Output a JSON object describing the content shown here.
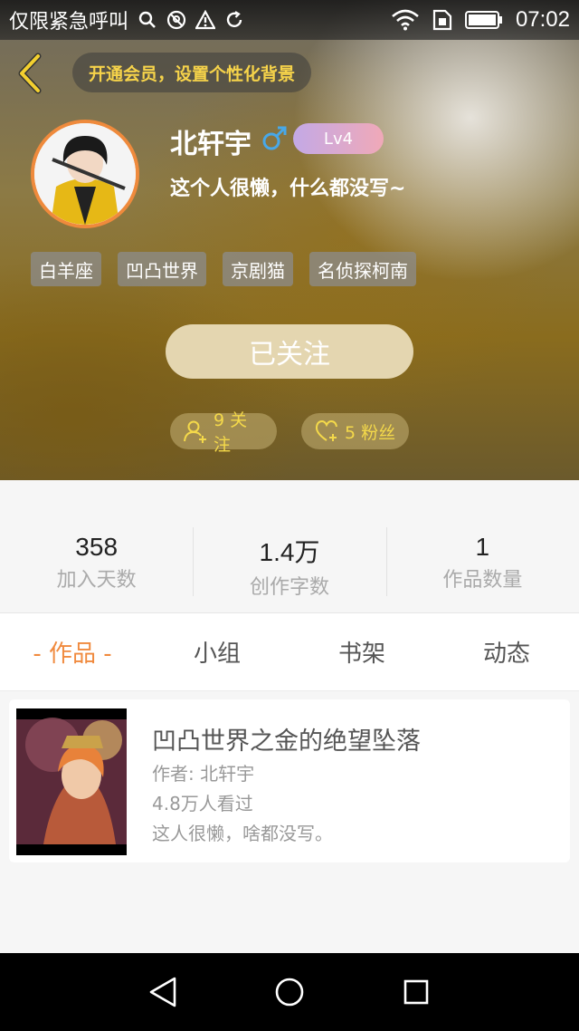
{
  "status_bar": {
    "carrier": "仅限紧急呼叫",
    "time": "07:02",
    "icons": [
      "search-icon",
      "no-location-icon",
      "warning-icon",
      "sync-icon",
      "wifi-icon",
      "sim-icon",
      "battery-icon"
    ]
  },
  "header": {
    "vip_prompt": "开通会员，设置个性化背景",
    "username": "北轩宇",
    "gender_symbol": "♂",
    "level": "Lv4",
    "bio": "这个人很懒，什么都没写~",
    "tags": [
      "白羊座",
      "凹凸世界",
      "京剧猫",
      "名侦探柯南"
    ],
    "follow_button": "已关注",
    "following_count": "9 关注",
    "fans_count": "5 粉丝"
  },
  "stats": [
    {
      "value": "358",
      "label": "加入天数"
    },
    {
      "value": "1.4万",
      "label": "创作字数"
    },
    {
      "value": "1",
      "label": "作品数量"
    }
  ],
  "tabs": [
    {
      "label": "- 作品 -",
      "active": true
    },
    {
      "label": "小组",
      "active": false
    },
    {
      "label": "书架",
      "active": false
    },
    {
      "label": "动态",
      "active": false
    }
  ],
  "works": [
    {
      "title": "凹凸世界之金的绝望坠落",
      "author": "作者: 北轩宇",
      "views": "4.8万人看过",
      "description": "这人很懒，啥都没写。"
    }
  ],
  "colors": {
    "accent": "#f08a3e",
    "vip_text": "#f6d34a",
    "follow_button": "#e4d6b0",
    "gender": "#48a8e8"
  }
}
